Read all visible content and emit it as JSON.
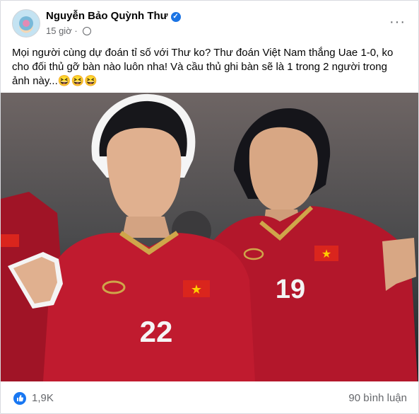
{
  "post": {
    "author": "Nguyễn Bảo Quỳnh Thư",
    "timestamp": "15 giờ",
    "text": "Mọi người cùng dự đoán tỉ số với Thư ko? Thư đoán Việt Nam thắng Uae 1-0, ko cho đối thủ gỡ bàn nào luôn nha! Và cầu thủ ghi bàn sẽ là 1 trong 2 người trong ảnh này...😆😆😆",
    "more_label": "···"
  },
  "photo": {
    "player_left_number": "22",
    "player_right_number": "19",
    "colors": {
      "jersey": "#b3172b",
      "trim": "#cfa64a",
      "flag_red": "#da251d",
      "flag_star": "#ffcd00"
    }
  },
  "footer": {
    "reaction_count": "1,9K",
    "comment_count": "90 bình luận"
  },
  "icons": {
    "verified": "verified-badge-icon",
    "globe": "globe-icon",
    "like": "like-icon",
    "more": "more-options-icon"
  },
  "colors": {
    "accent": "#1877f2",
    "secondary_text": "#65676b"
  }
}
